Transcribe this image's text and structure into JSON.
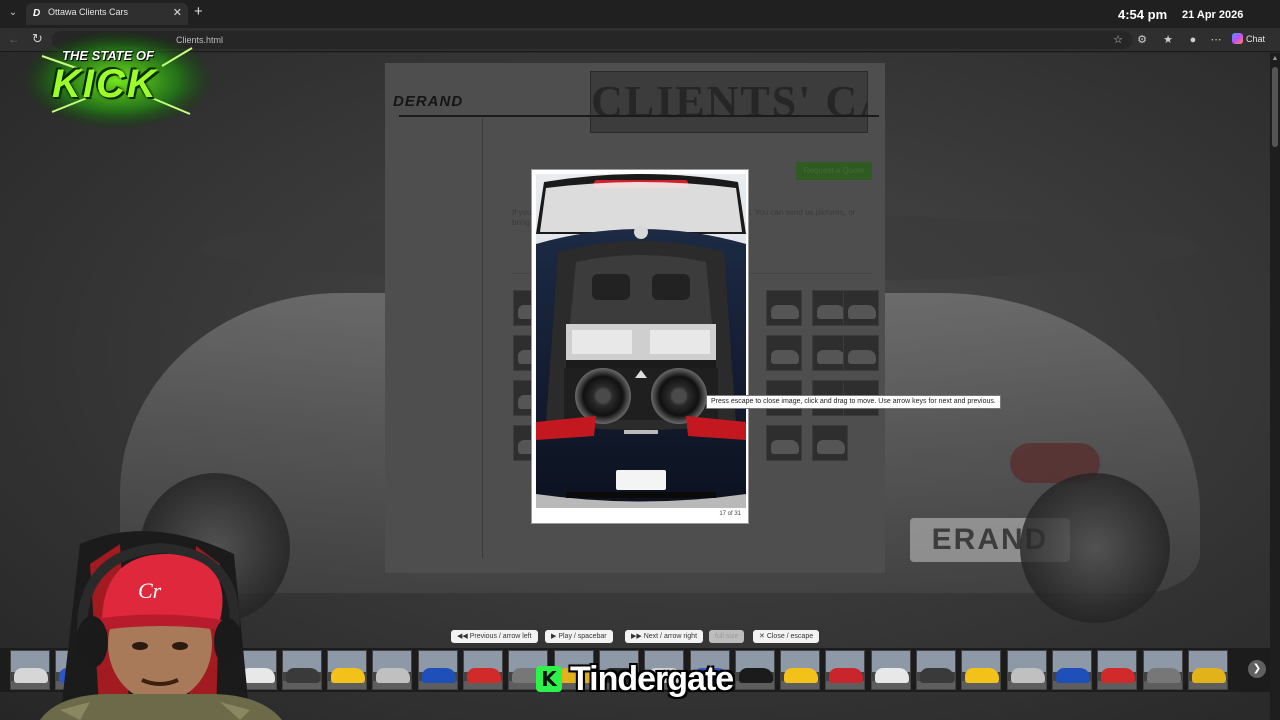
{
  "browser": {
    "tab_title": "Ottawa Clients Cars",
    "tab_favicon": "D",
    "url_fragment": "Clients.html",
    "chat_label": "Chat",
    "clock": "4:54 pm",
    "date": "21 Apr 2026",
    "icons": [
      "tab-menu-icon",
      "close-icon",
      "plus-icon",
      "back-icon",
      "reload-icon",
      "star-icon",
      "extensions-icon",
      "favorites-icon",
      "profile-icon",
      "more-icon",
      "copilot-icon"
    ]
  },
  "site": {
    "logo": "DERAND",
    "heading": "CLIENTS' CARS",
    "request_button": "Request a Quote",
    "intro_text": "If you would like your car featured on this page, let us know about it. You can send us pictures, or bring it in and we will take the picture for you.",
    "thumbnail_rows": 4
  },
  "lightbox": {
    "counter": "17 of 31",
    "tooltip": "Press escape to close image, click and drag to move. Use arrow keys for next and previous."
  },
  "controls": {
    "previous": "Previous / arrow left",
    "play": "Play / spacebar",
    "next": "Next / arrow right",
    "full_size": "full size",
    "close": "Close / escape"
  },
  "strip": {
    "thumbnail_count": 27,
    "next_icon": "chevron-right-icon"
  },
  "overlay": {
    "stream_logo_line1": "THE STATE OF",
    "stream_logo_line2": "KICK",
    "caption_badge": "K",
    "caption_text": "Tindergate"
  },
  "colors": {
    "logo_green": "#7dff1a",
    "caption_green": "#2df24a",
    "webcam_hat": "#e0283c",
    "lightbox_border": "#ffffff"
  }
}
